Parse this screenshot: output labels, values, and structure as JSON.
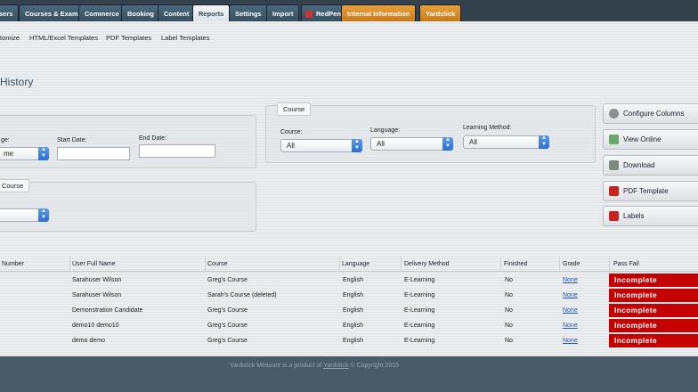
{
  "nav": {
    "tabs": [
      {
        "label": "sers"
      },
      {
        "label": "Courses & Exams"
      },
      {
        "label": "Commerce"
      },
      {
        "label": "Booking"
      },
      {
        "label": "Content"
      },
      {
        "label": "Reports"
      },
      {
        "label": "Settings"
      },
      {
        "label": "Import"
      },
      {
        "label": "RedPen"
      },
      {
        "label": "Internal Information"
      },
      {
        "label": "Yardstick"
      }
    ]
  },
  "subnav": {
    "items": [
      "tomize",
      "HTML/Excel Templates",
      "PDF Templates",
      "Label Templates"
    ]
  },
  "page": {
    "title": "History"
  },
  "left_panel": {
    "type_label": "ge:",
    "type_value": "me",
    "start_date_label": "Start Date:",
    "start_date_value": "",
    "end_date_label": "End Date:",
    "end_date_value": ""
  },
  "course_sub_panel": {
    "legend": "Course"
  },
  "course_panel": {
    "legend": "Course",
    "course_label": "Course:",
    "course_value": "All",
    "language_label": "Language:",
    "language_value": "All",
    "method_label": "Learning Method:",
    "method_value": "All"
  },
  "actions": {
    "configure_columns": "Configure Columns",
    "view_online": "View Online",
    "download": "Download",
    "pdf_template": "PDF Template",
    "labels": "Labels"
  },
  "table": {
    "headers": [
      "Number",
      "User Full Name",
      "Course",
      "Language",
      "Delivery Method",
      "Finished",
      "Grade",
      "Pass Fail"
    ],
    "rows": [
      {
        "name": "Sarahuser Wilson",
        "course": "Greg's Course",
        "language": "English",
        "method": "E-Learning",
        "finished": "No",
        "grade": "None",
        "pass_fail": "Incomplete"
      },
      {
        "name": "Sarahuser Wilson",
        "course": "Sarah's Course (deleted)",
        "language": "English",
        "method": "E-Learning",
        "finished": "No",
        "grade": "None",
        "pass_fail": "Incomplete"
      },
      {
        "name": "Demonstration Candidate",
        "course": "Greg's Course",
        "language": "English",
        "method": "E-Learning",
        "finished": "No",
        "grade": "None",
        "pass_fail": "Incomplete"
      },
      {
        "name": "demo10 demo10",
        "course": "Greg's Course",
        "language": "English",
        "method": "E-Learning",
        "finished": "No",
        "grade": "None",
        "pass_fail": "Incomplete"
      },
      {
        "name": "demo demo",
        "course": "Greg's Course",
        "language": "English",
        "method": "E-Learning",
        "finished": "No",
        "grade": "None",
        "pass_fail": "Incomplete"
      }
    ]
  },
  "footer": {
    "prefix": "Yardstick Measure is a product of",
    "link": "Yardstick",
    "suffix": "© Copyright 2015"
  },
  "colors": {
    "tab_bg": "#35505f",
    "accent_orange": "#e8a03a",
    "incomplete_red": "#c40000",
    "link_blue": "#2255bb"
  }
}
